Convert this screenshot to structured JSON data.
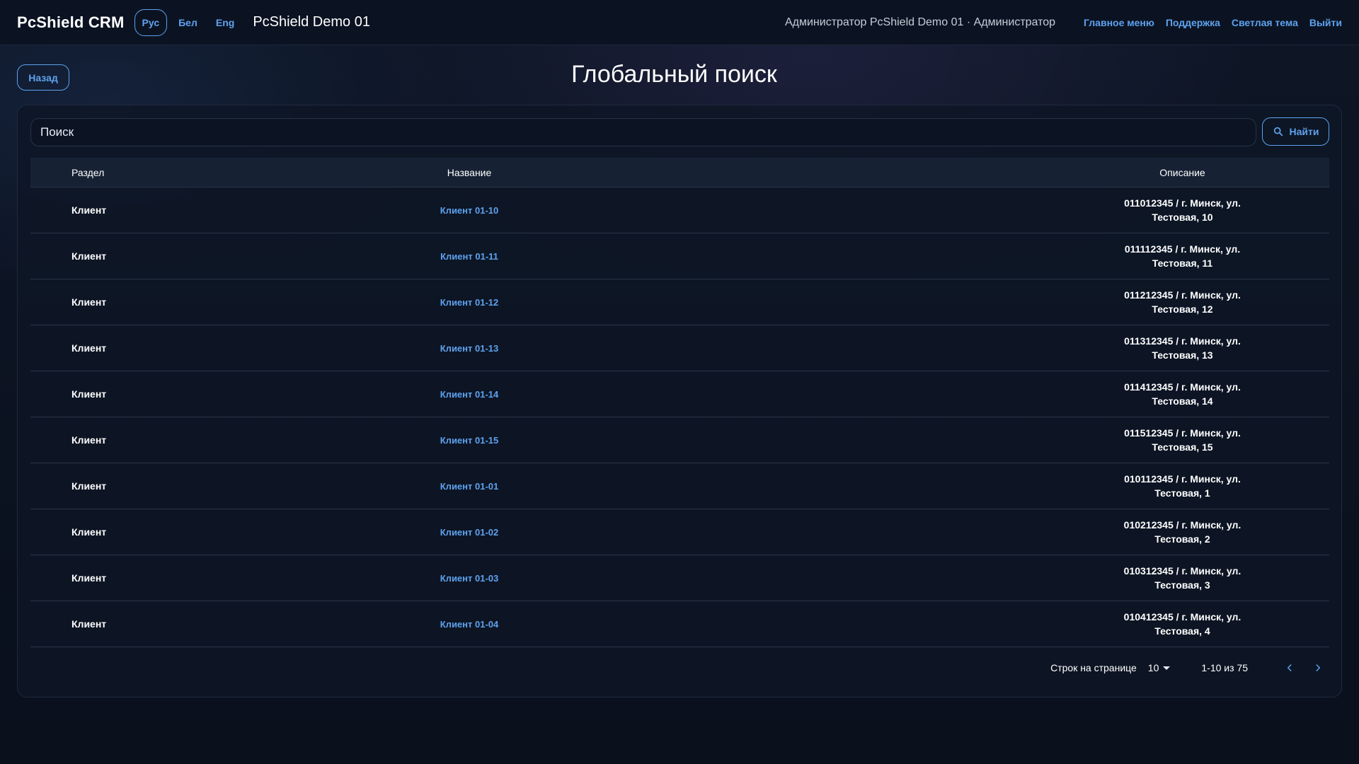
{
  "header": {
    "brand": "PcShield CRM",
    "languages": [
      {
        "label": "Рус",
        "active": true
      },
      {
        "label": "Бел",
        "active": false
      },
      {
        "label": "Eng",
        "active": false
      }
    ],
    "tenant": "PcShield Demo 01",
    "user": "Администратор PcShield Demo 01 · Администратор",
    "nav": [
      "Главное меню",
      "Поддержка",
      "Светлая тема",
      "Выйти"
    ]
  },
  "page": {
    "back_label": "Назад",
    "title": "Глобальный поиск"
  },
  "search": {
    "placeholder": "Поиск",
    "button_label": "Найти"
  },
  "table": {
    "columns": [
      "Раздел",
      "Название",
      "Описание"
    ],
    "rows": [
      {
        "section": "Клиент",
        "name": "Клиент 01-10",
        "desc_line1": "011012345 / г. Минск, ул.",
        "desc_line2": "Тестовая, 10"
      },
      {
        "section": "Клиент",
        "name": "Клиент 01-11",
        "desc_line1": "011112345 / г. Минск, ул.",
        "desc_line2": "Тестовая, 11"
      },
      {
        "section": "Клиент",
        "name": "Клиент 01-12",
        "desc_line1": "011212345 / г. Минск, ул.",
        "desc_line2": "Тестовая, 12"
      },
      {
        "section": "Клиент",
        "name": "Клиент 01-13",
        "desc_line1": "011312345 / г. Минск, ул.",
        "desc_line2": "Тестовая, 13"
      },
      {
        "section": "Клиент",
        "name": "Клиент 01-14",
        "desc_line1": "011412345 / г. Минск, ул.",
        "desc_line2": "Тестовая, 14"
      },
      {
        "section": "Клиент",
        "name": "Клиент 01-15",
        "desc_line1": "011512345 / г. Минск, ул.",
        "desc_line2": "Тестовая, 15"
      },
      {
        "section": "Клиент",
        "name": "Клиент 01-01",
        "desc_line1": "010112345 / г. Минск, ул.",
        "desc_line2": "Тестовая, 1"
      },
      {
        "section": "Клиент",
        "name": "Клиент 01-02",
        "desc_line1": "010212345 / г. Минск, ул.",
        "desc_line2": "Тестовая, 2"
      },
      {
        "section": "Клиент",
        "name": "Клиент 01-03",
        "desc_line1": "010312345 / г. Минск, ул.",
        "desc_line2": "Тестовая, 3"
      },
      {
        "section": "Клиент",
        "name": "Клиент 01-04",
        "desc_line1": "010412345 / г. Минск, ул.",
        "desc_line2": "Тестовая, 4"
      }
    ]
  },
  "pagination": {
    "rows_per_page_label": "Строк на странице",
    "rows_per_page": "10",
    "range": "1-10 из 75"
  },
  "colors": {
    "accent": "#5ea2ee",
    "background": "#0b1220",
    "card": "#0e1626"
  },
  "icons": {
    "search_button": "search-icon",
    "select_caret": "caret-down-icon",
    "prev_page": "chevron-left-icon",
    "next_page": "chevron-right-icon"
  }
}
